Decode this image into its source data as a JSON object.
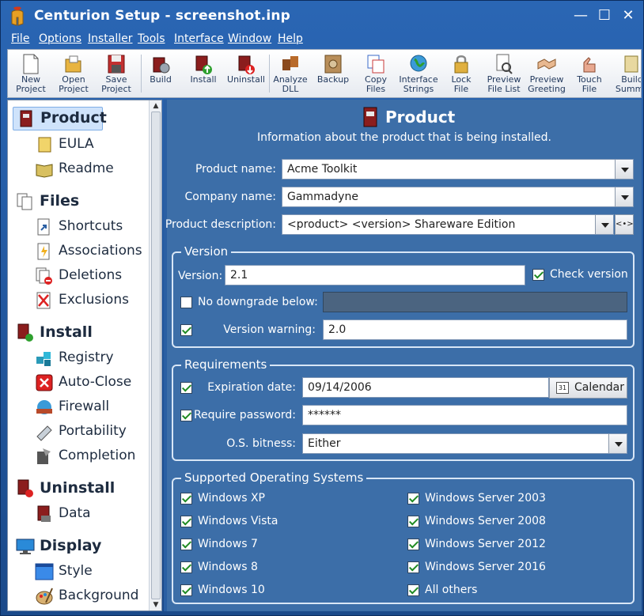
{
  "window": {
    "title": "Centurion Setup - screenshot.inp",
    "minimize": "—",
    "maximize": "☐",
    "close": "✕"
  },
  "menu": [
    "File",
    "Options",
    "Installer",
    "Tools",
    "Interface",
    "Window",
    "Help"
  ],
  "toolbar": [
    {
      "label": "New\nProject",
      "icon": "new-project-icon"
    },
    {
      "label": "Open\nProject",
      "icon": "open-project-icon"
    },
    {
      "label": "Save\nProject",
      "icon": "save-project-icon"
    },
    {
      "label": "Build",
      "icon": "build-icon"
    },
    {
      "label": "Install",
      "icon": "install-icon"
    },
    {
      "label": "Uninstall",
      "icon": "uninstall-icon"
    },
    {
      "label": "Analyze\nDLL",
      "icon": "analyze-dll-icon"
    },
    {
      "label": "Backup",
      "icon": "backup-icon"
    },
    {
      "label": "Copy\nFiles",
      "icon": "copy-files-icon"
    },
    {
      "label": "Interface\nStrings",
      "icon": "interface-strings-icon"
    },
    {
      "label": "Lock\nFile",
      "icon": "lock-file-icon"
    },
    {
      "label": "Preview\nFile List",
      "icon": "preview-file-list-icon"
    },
    {
      "label": "Preview\nGreeting",
      "icon": "preview-greeting-icon"
    },
    {
      "label": "Touch\nFile",
      "icon": "touch-file-icon"
    },
    {
      "label": "Build\nSumma",
      "icon": "build-summary-icon"
    }
  ],
  "sidebar": {
    "items": [
      {
        "label": "Product",
        "heading": true,
        "selected": true
      },
      {
        "label": "EULA"
      },
      {
        "label": "Readme"
      },
      {
        "label": "Files",
        "heading": true
      },
      {
        "label": "Shortcuts"
      },
      {
        "label": "Associations"
      },
      {
        "label": "Deletions"
      },
      {
        "label": "Exclusions"
      },
      {
        "label": "Install",
        "heading": true
      },
      {
        "label": "Registry"
      },
      {
        "label": "Auto-Close"
      },
      {
        "label": "Firewall"
      },
      {
        "label": "Portability"
      },
      {
        "label": "Completion"
      },
      {
        "label": "Uninstall",
        "heading": true
      },
      {
        "label": "Data"
      },
      {
        "label": "Display",
        "heading": true
      },
      {
        "label": "Style"
      },
      {
        "label": "Background"
      }
    ]
  },
  "page": {
    "title": "Product",
    "subtitle": "Information about the product that is being installed.",
    "product_name_label": "Product name:",
    "product_name": "Acme Toolkit",
    "company_name_label": "Company name:",
    "company_name": "Gammadyne",
    "product_description_label": "Product description:",
    "product_description": "<product> <version> Shareware Edition",
    "expand_button": "<•>"
  },
  "version_group": {
    "title": "Version",
    "version_label": "Version:",
    "version": "2.1",
    "check_version_label": "Check version",
    "check_version": true,
    "no_downgrade_label": "No downgrade below:",
    "no_downgrade": false,
    "no_downgrade_value": "",
    "version_warning_enabled": true,
    "version_warning_label": "Version warning:",
    "version_warning": "2.0"
  },
  "requirements_group": {
    "title": "Requirements",
    "expiration_enabled": true,
    "expiration_label": "Expiration date:",
    "expiration_date": "09/14/2006",
    "calendar_button": "Calendar",
    "calendar_icon_text": "31",
    "password_enabled": true,
    "password_label": "Require password:",
    "password": "******",
    "bitness_label": "O.S. bitness:",
    "bitness": "Either"
  },
  "os_group": {
    "title": "Supported Operating Systems",
    "left": [
      {
        "label": "Windows XP",
        "checked": true
      },
      {
        "label": "Windows Vista",
        "checked": true
      },
      {
        "label": "Windows 7",
        "checked": true
      },
      {
        "label": "Windows 8",
        "checked": true
      },
      {
        "label": "Windows 10",
        "checked": true
      }
    ],
    "right": [
      {
        "label": "Windows Server 2003",
        "checked": true
      },
      {
        "label": "Windows Server 2008",
        "checked": true
      },
      {
        "label": "Windows Server 2012",
        "checked": true
      },
      {
        "label": "Windows Server 2016",
        "checked": true
      },
      {
        "label": "All others",
        "checked": true
      }
    ]
  },
  "colors": {
    "frame": "#2a66b4",
    "panel": "#3c6ea8",
    "selected": "#cfe3fb",
    "check": "#1f8a22"
  }
}
